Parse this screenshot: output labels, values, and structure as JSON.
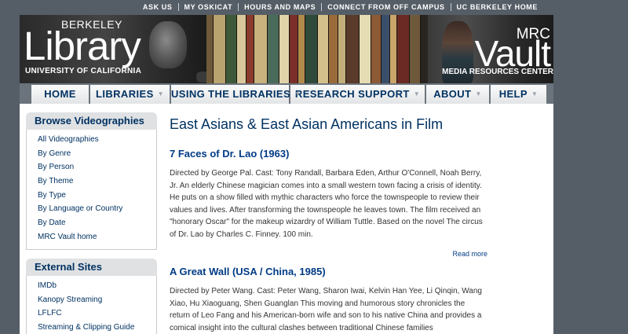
{
  "utility_links": [
    "ASK US",
    "MY OSKICAT",
    "HOURS AND MAPS",
    "CONNECT FROM OFF CAMPUS",
    "UC BERKELEY HOME"
  ],
  "banner": {
    "left_logo": {
      "top": "BERKELEY",
      "main": "Library",
      "sub": "UNIVERSITY OF CALIFORNIA"
    },
    "right_logo": {
      "top": "MRC",
      "main": "Vault",
      "sub": "MEDIA RESOURCES CENTER"
    }
  },
  "nav": [
    {
      "label": "HOME",
      "caret": false
    },
    {
      "label": "LIBRARIES",
      "caret": true
    },
    {
      "label": "USING THE LIBRARIES",
      "caret": true
    },
    {
      "label": "RESEARCH SUPPORT",
      "caret": true
    },
    {
      "label": "ABOUT",
      "caret": true
    },
    {
      "label": "HELP",
      "caret": true
    }
  ],
  "sidebar": {
    "videographies": {
      "heading": "Browse Videographies",
      "items": [
        "All Videographies",
        "By Genre",
        "By Person",
        "By Theme",
        "By Type",
        "By Language or Country",
        "By Date",
        "MRC Vault home"
      ]
    },
    "external": {
      "heading": "External Sites",
      "items": [
        "IMDb",
        "Kanopy Streaming",
        "LFLFC",
        "Streaming & Clipping Guide"
      ]
    }
  },
  "page": {
    "title": "East Asians & East Asian Americans in Film",
    "films": [
      {
        "title": "7 Faces of Dr. Lao (1963)",
        "description": "Directed by George Pal. Cast: Tony Randall, Barbara Eden, Arthur O'Connell, Noah Berry, Jr. An elderly Chinese magician comes into a small western town facing a crisis of identity. He puts on a show filled with mythic characters who force the townspeople to review their values and lives. After transforming the townspeople he leaves town. The film received an \"honorary Oscar\" for the makeup wizardry of William Tuttle. Based on the novel The circus of Dr. Lao by Charles C. Finney. 100 min.",
        "read_more": "Read more"
      },
      {
        "title": "A Great Wall (USA / China, 1985)",
        "description": "Directed by Peter Wang. Cast: Peter Wang, Sharon Iwai, Kelvin Han Yee, Li Qinqin, Wang Xiao, Hu Xiaoguang, Shen Guanglan This moving and humorous story chronicles the return of Leo Fang and his American-born wife and son to his native China and provides a comical insight into the cultural clashes between traditional Chinese families"
      }
    ]
  },
  "colors": {
    "brand_navy": "#003262",
    "link_blue": "#003b85",
    "page_bg": "#555e66"
  }
}
